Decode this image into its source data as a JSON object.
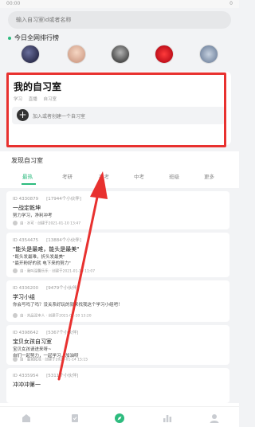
{
  "status": {
    "time": "00:00",
    "right": "0"
  },
  "search": {
    "placeholder": "输入自习室id或者名称"
  },
  "ranking": {
    "title": "今日全网排行榜",
    "avatars": [
      "avatar-1",
      "avatar-2",
      "avatar-3",
      "avatar-4",
      "avatar-5"
    ]
  },
  "my_room": {
    "title": "我的自习室",
    "tags": [
      "学习",
      "直播",
      "自习室"
    ],
    "create_text": "加入或者创建一个自习室",
    "plus": "+"
  },
  "discover": {
    "title": "发现自习室",
    "tabs": [
      "最热",
      "考研",
      "高考",
      "中考",
      "班级",
      "更多"
    ],
    "active_tab": "最热",
    "rooms": [
      {
        "id": "ID 4330879",
        "count": "[17944个小伙伴]",
        "name": "一战定乾坤",
        "desc": [
          "努力学习，净利冲考"
        ],
        "foot": "自 · 水可 · 创建于2021-01-10 13:47"
      },
      {
        "id": "ID 4354475",
        "count": "[13884个小伙伴]",
        "name": "\"能头是最难，能头是最美\"",
        "desc": [
          "\"既头发最难，折头发最美\"",
          "\"最开粉好的就 电下来的努力\""
        ],
        "foot": "自 · 我叫温馨乐乐 · 创建于2021-01-10 11:07"
      },
      {
        "id": "ID 4336200",
        "count": "[9479个小伙伴]",
        "name": "学习小组",
        "desc": [
          "你会写吗了吗？没关系好玩的就来找我这个学习小组吧！"
        ],
        "foot": "自 · 刘品泥本人 · 创建于2021-01-10 13:20"
      },
      {
        "id": "ID 4398642",
        "count": "[5367个小伙伴]",
        "name": "宝贝女孩自习室",
        "desc": [
          "宝贝女孩请进来呀~",
          "自们一起努力，一起学习，加油呀"
        ],
        "foot": "自 · 金城拓瑶 · 创建于2021-01-14 15:15"
      },
      {
        "id": "ID 4335954",
        "count": "[5311个小伙伴]",
        "name": "冲冲冲第一",
        "desc": [],
        "foot": ""
      }
    ]
  },
  "tabbar": {
    "items": [
      "home-icon",
      "task-icon",
      "discover-icon",
      "stats-icon",
      "profile-icon"
    ]
  },
  "colors": {
    "accent": "#2dbb7e",
    "highlight": "#e8312f",
    "text": "#222222",
    "muted": "#999999"
  }
}
